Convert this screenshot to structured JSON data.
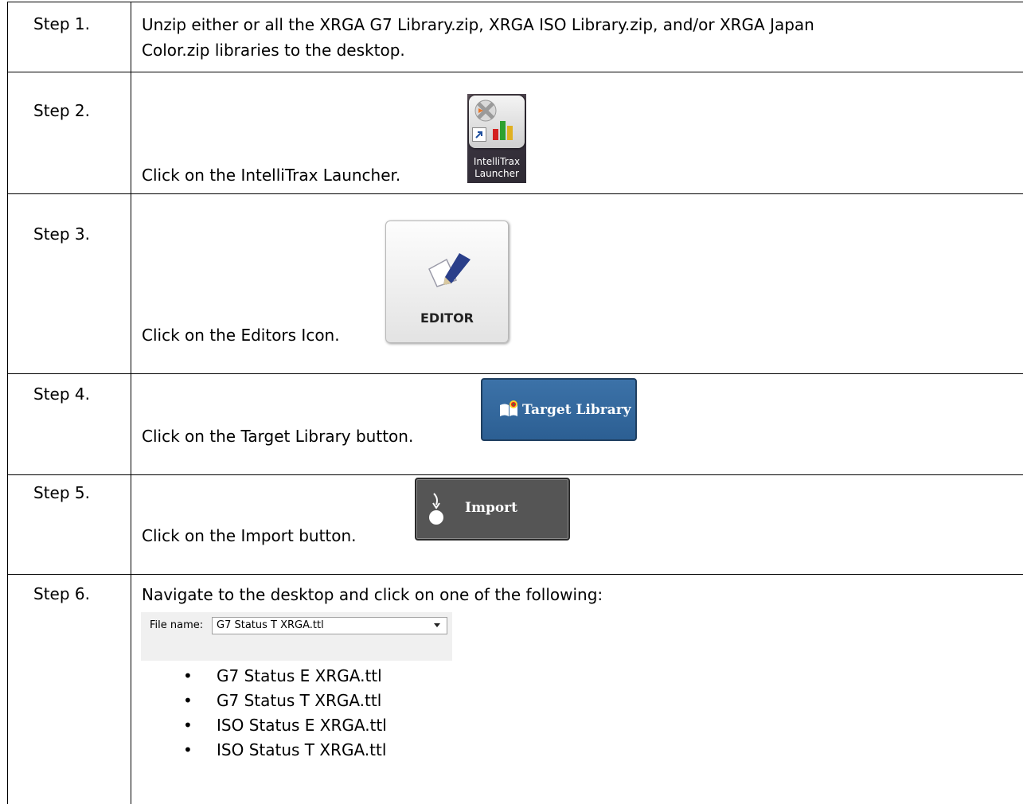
{
  "steps": [
    {
      "label": "Step 1.",
      "text_line1": "Unzip either or all the XRGA G7 Library.zip, XRGA ISO Library.zip, and/or XRGA Japan",
      "text_line2": "Color.zip libraries to the desktop."
    },
    {
      "label": "Step 2.",
      "text": "Click on the IntelliTrax Launcher."
    },
    {
      "label": "Step 3.",
      "text": "Click on the Editors Icon."
    },
    {
      "label": "Step 4.",
      "text": "Click on the Target Library button."
    },
    {
      "label": "Step 5.",
      "text": "Click on the Import button."
    },
    {
      "label": "Step 6.",
      "text": "Navigate to the desktop and click on one of the following:"
    }
  ],
  "launcher_icon": {
    "caption_line1": "IntelliTrax",
    "caption_line2": "Launcher",
    "icon": "intellitrax-launcher-icon"
  },
  "editor_icon": {
    "label": "EDITOR",
    "icon": "pen-paper-icon"
  },
  "target_button": {
    "label": "Target Library",
    "icon": "open-book-target-icon",
    "color": "#2f6399"
  },
  "import_button": {
    "label": "Import",
    "icon": "import-arrow-icon",
    "color": "#555555"
  },
  "file_dialog": {
    "label": "File name:",
    "value": "G7 Status T XRGA.ttl"
  },
  "files": [
    "G7 Status E XRGA.ttl",
    "G7 Status T XRGA.ttl",
    "ISO Status E XRGA.ttl",
    "ISO Status T XRGA.ttl"
  ],
  "bullet": "•"
}
